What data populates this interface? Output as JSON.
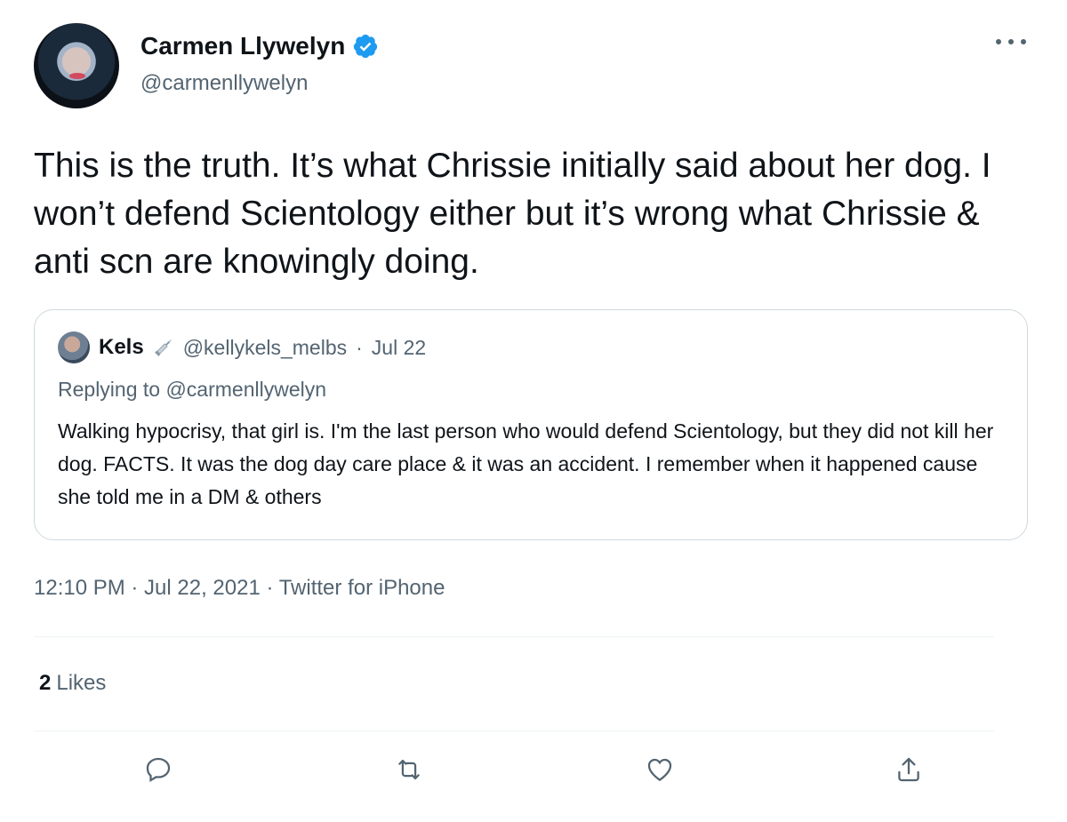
{
  "author": {
    "display_name": "Carmen Llywelyn",
    "handle": "@carmenllywelyn",
    "verified": true
  },
  "tweet": {
    "text": "This is the truth. It’s what Chrissie initially said about her dog. I won’t defend Scientology either but it’s wrong what Chrissie & anti scn are knowingly doing."
  },
  "quote": {
    "display_name": "Kels",
    "handle": "@kellykels_melbs",
    "separator": "·",
    "date": "Jul 22",
    "replying_to": "Replying to @carmenllywelyn",
    "text": "Walking hypocrisy, that girl is. I'm the last person who would defend Scientology, but they did not kill her dog. FACTS. It was the dog day care place & it was an accident. I remember when it happened cause she told me in a DM & others"
  },
  "meta": {
    "timestamp": "12:10 PM · Jul 22, 2021 · Twitter for iPhone"
  },
  "stats": {
    "likes_count": "2",
    "likes_label": "Likes"
  },
  "colors": {
    "verified": "#1d9bf0",
    "secondary_text": "#536471",
    "primary_text": "#0f1419",
    "border": "#cfd9de"
  },
  "icons": {
    "more": "more-icon",
    "reply": "reply-icon",
    "retweet": "retweet-icon",
    "like": "heart-icon",
    "share": "share-icon"
  }
}
